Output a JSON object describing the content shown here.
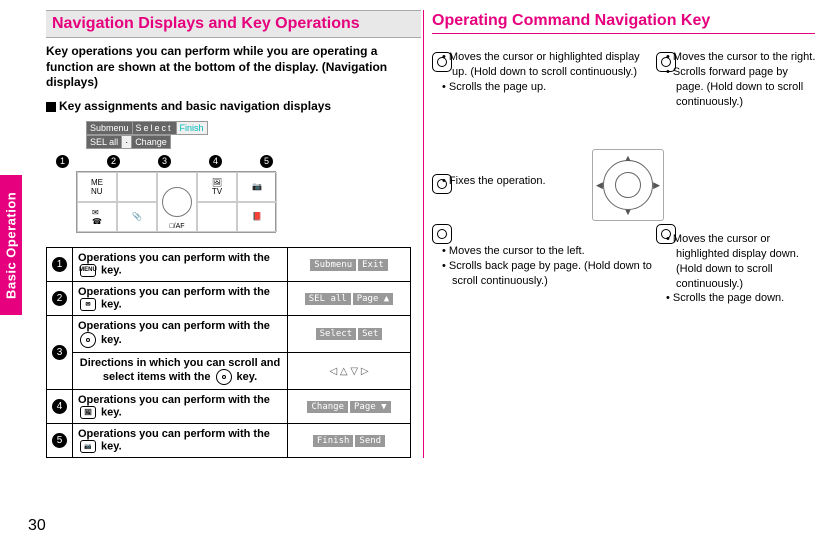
{
  "side_tab": "Basic Operation",
  "page_number": "30",
  "left": {
    "heading": "Navigation Displays and Key Operations",
    "intro": "Key operations you can perform while you are operating a function are shown at the bottom of the display. (Navigation displays)",
    "block_label": "Key assignments and basic navigation displays",
    "diagram": {
      "top_cells": [
        "Submenu",
        "Select",
        "Finish"
      ],
      "top_cells2": [
        "SEL all",
        "·",
        "Change"
      ],
      "nums": [
        "1",
        "2",
        "3",
        "4",
        "5"
      ],
      "keypad_labels": [
        "ME NU",
        "",
        "",
        "",
        "",
        " ",
        "",
        "□/AF",
        "",
        ""
      ]
    },
    "rows": [
      {
        "n": "1",
        "desc_before": "Operations you can perform with the ",
        "key": "MENU",
        "desc_after": " key.",
        "badges": [
          "Submenu",
          "Exit"
        ]
      },
      {
        "n": "2",
        "desc_before": "Operations you can perform with the ",
        "key": "✉",
        "desc_after": " key.",
        "badges": [
          "SEL all",
          "Page ▲"
        ]
      },
      {
        "n": "3",
        "desc_before": "Operations you can perform with the ",
        "key": "○",
        "desc_after": " key.",
        "badges": [
          "Select",
          "Set"
        ],
        "extra_before": "Directions in which you can scroll and select items with the ",
        "extra_key": "◎",
        "extra_after": " key.",
        "extra_badge": "◁ △ ▽ ▷"
      },
      {
        "n": "4",
        "desc_before": "Operations you can perform with the ",
        "key": "🖼",
        "desc_after": " key.",
        "badges": [
          "Change",
          "Page ▼"
        ]
      },
      {
        "n": "5",
        "desc_before": "Operations you can perform with the ",
        "key": "📷",
        "desc_after": " key.",
        "badges": [
          "Finish",
          "Send"
        ]
      }
    ]
  },
  "right": {
    "heading": "Operating Command Navigation Key",
    "blocks": {
      "up": [
        "Moves the cursor or highlighted display up. (Hold down to scroll continuously.)",
        "Scrolls the page up."
      ],
      "right": [
        "Moves the cursor to the right.",
        "Scrolls forward page by page. (Hold down to scroll continuously.)"
      ],
      "center": [
        "Fixes the operation."
      ],
      "left": [
        "Moves the cursor to the left.",
        "Scrolls back page by page. (Hold down to scroll continuously.)"
      ],
      "down": [
        "Moves the cursor or highlighted display down. (Hold down to scroll continuously.)",
        "Scrolls the page down."
      ]
    }
  }
}
